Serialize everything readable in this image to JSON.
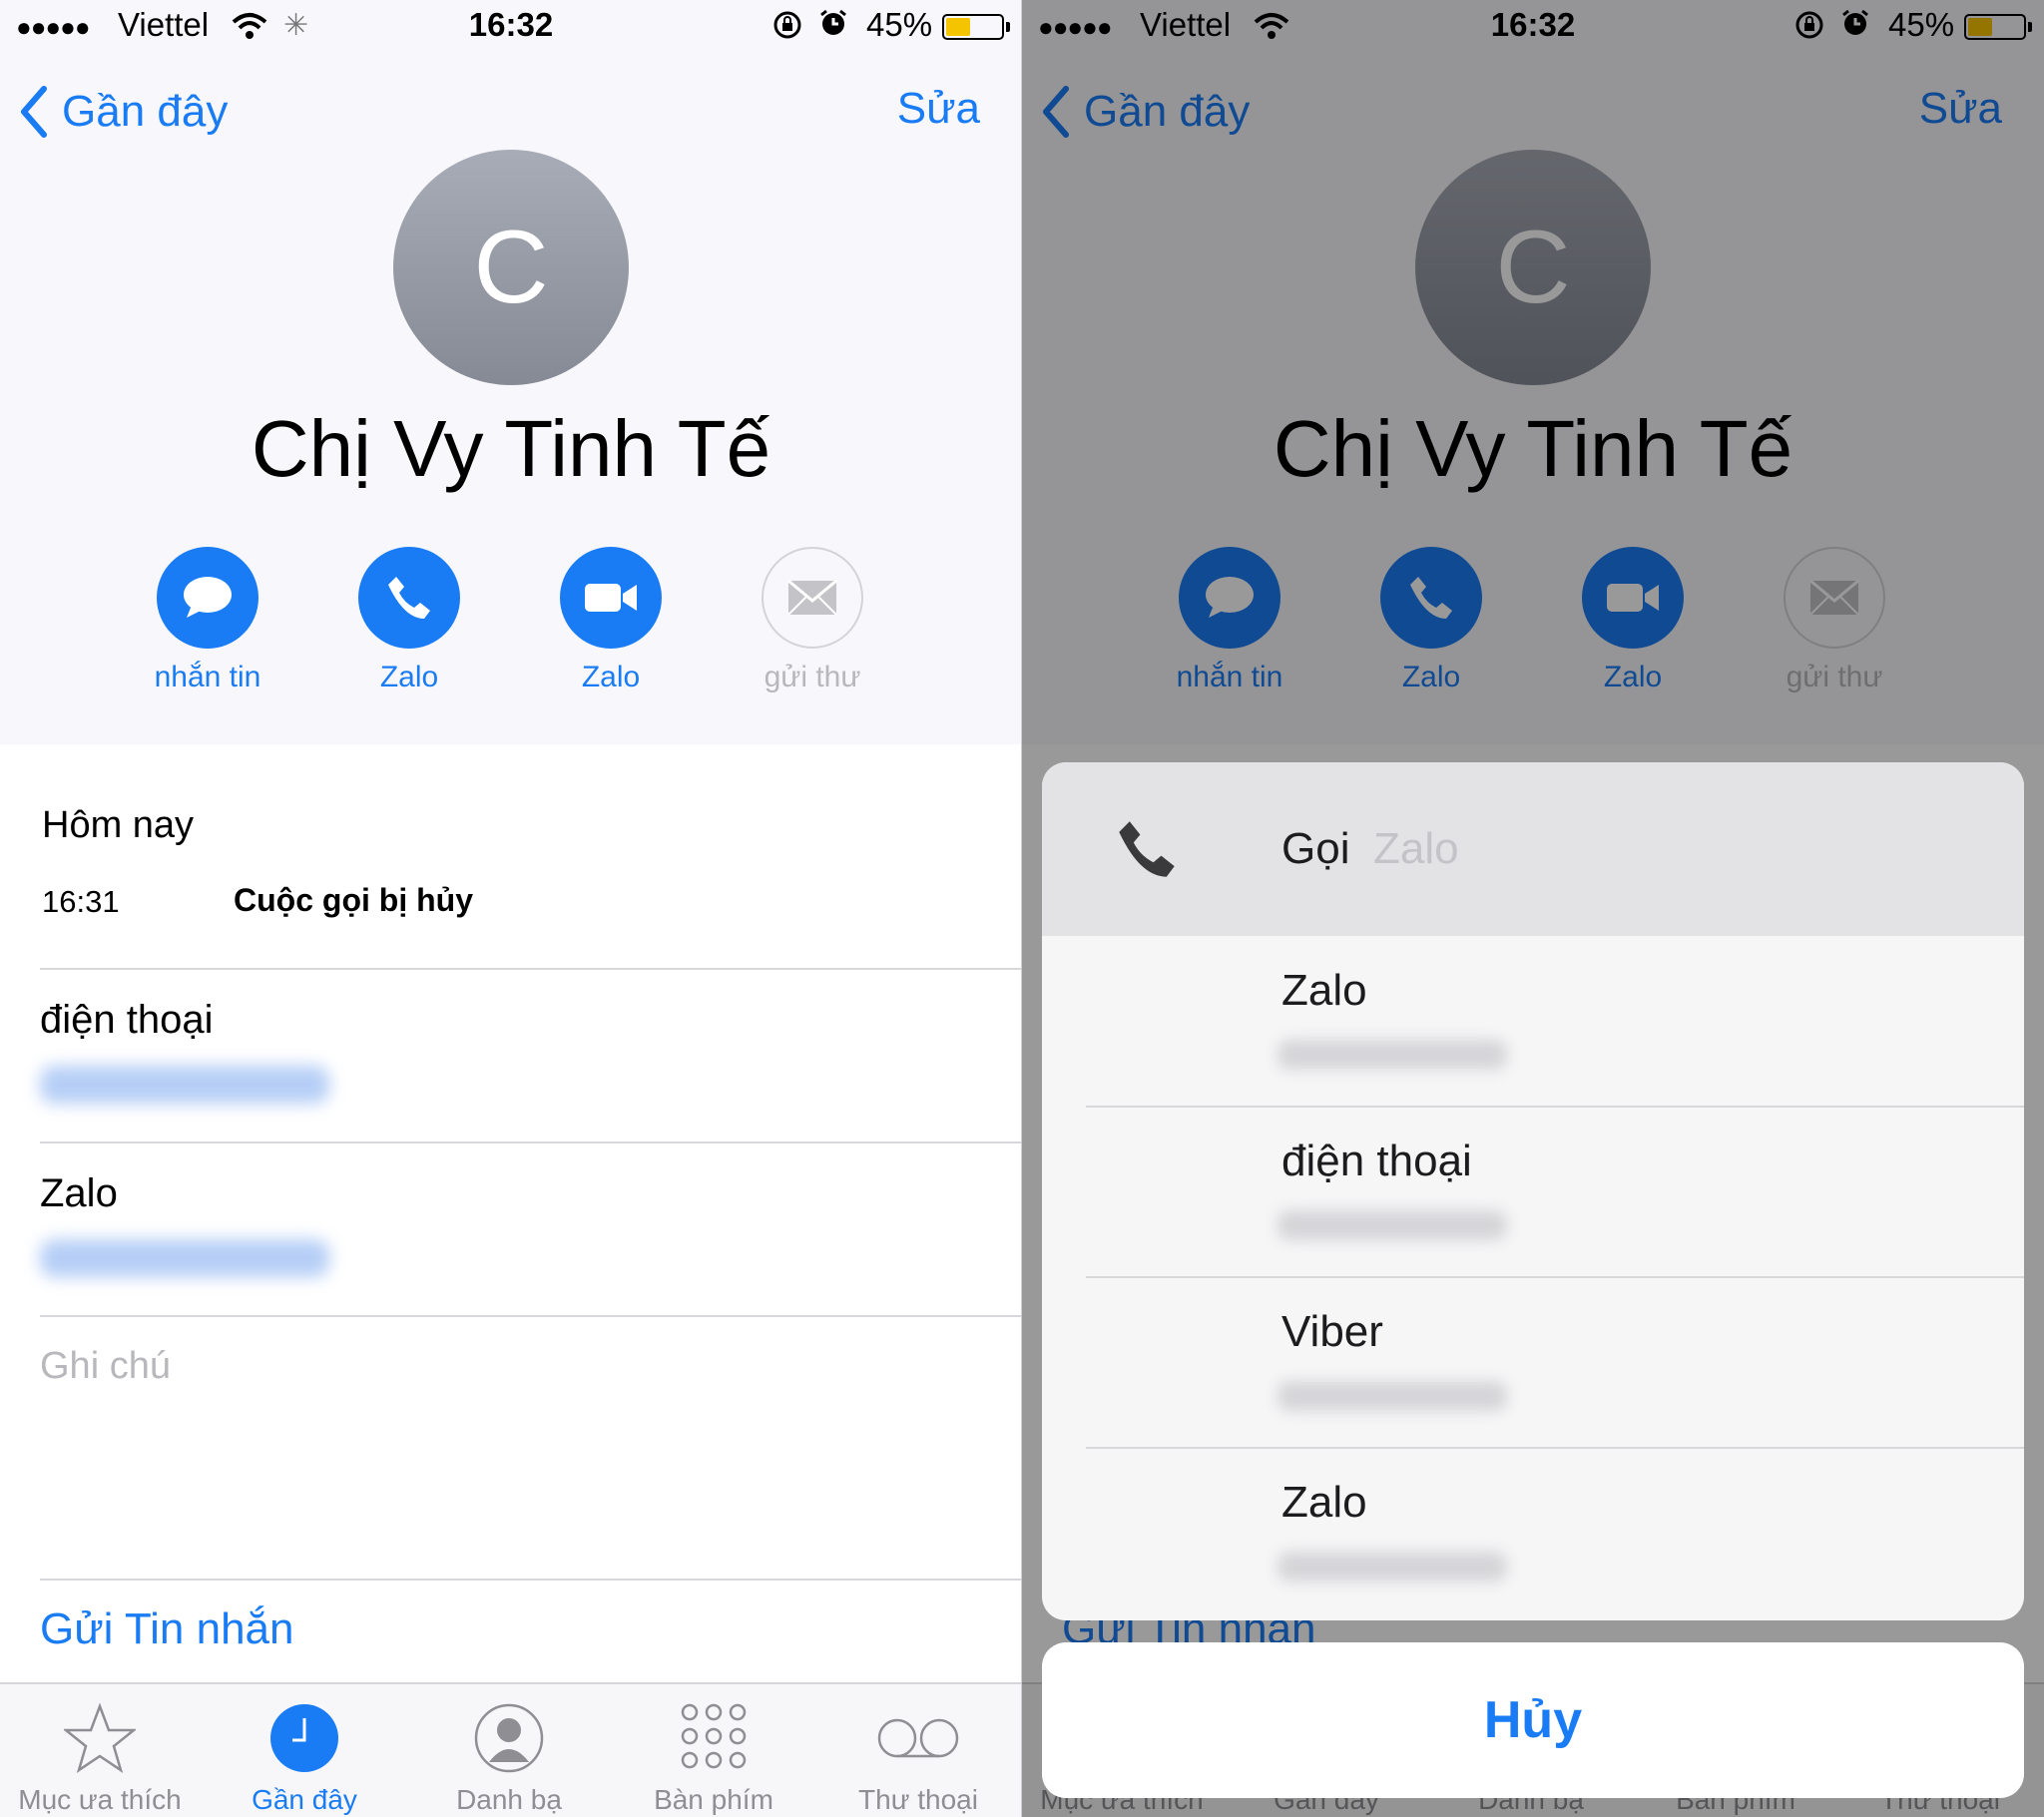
{
  "status": {
    "signal": "●●●●●",
    "carrier": "Viettel",
    "time": "16:32",
    "battery": "45%",
    "battery_level": 0.45
  },
  "nav": {
    "back_label": "Gần đây",
    "edit_label": "Sửa"
  },
  "contact": {
    "initial": "C",
    "name": "Chị Vy Tinh Tế"
  },
  "actions": [
    {
      "label": "nhắn tin",
      "icon": "message-icon",
      "enabled": true
    },
    {
      "label": "Zalo",
      "icon": "phone-icon",
      "enabled": true
    },
    {
      "label": "Zalo",
      "icon": "video-icon",
      "enabled": true
    },
    {
      "label": "gửi thư",
      "icon": "mail-icon",
      "enabled": false
    }
  ],
  "recents": {
    "heading": "Hôm nay",
    "time": "16:31",
    "status": "Cuộc gọi bị hủy"
  },
  "fields": [
    {
      "label": "điện thoại"
    },
    {
      "label": "Zalo"
    }
  ],
  "notes_label": "Ghi chú",
  "send_message": "Gửi Tin nhắn",
  "tabs": [
    {
      "label": "Mục ưa thích",
      "icon": "star-icon"
    },
    {
      "label": "Gần đây",
      "icon": "clock-icon",
      "active": true
    },
    {
      "label": "Danh bạ",
      "icon": "person-icon"
    },
    {
      "label": "Bàn phím",
      "icon": "keypad-icon"
    },
    {
      "label": "Thư thoại",
      "icon": "voicemail-icon"
    }
  ],
  "sheet": {
    "title": "Gọi",
    "subtitle": "Zalo",
    "options": [
      {
        "label": "Zalo"
      },
      {
        "label": "điện thoại"
      },
      {
        "label": "Viber"
      },
      {
        "label": "Zalo"
      }
    ],
    "cancel_label": "Hủy"
  },
  "colors": {
    "accent": "#1a7cf5",
    "battery": "#f5c400"
  }
}
